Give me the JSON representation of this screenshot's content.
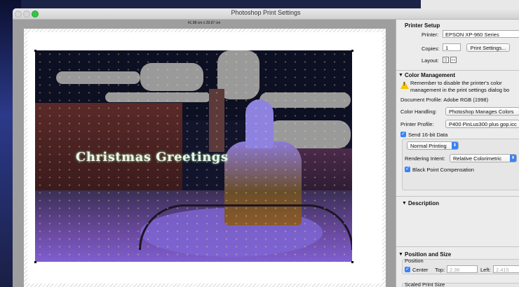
{
  "window": {
    "title": "Photoshop Print Settings"
  },
  "preview": {
    "paper_size": "41.98 cm x 29.67 cm",
    "overlay_text": "Christmas Greetings"
  },
  "printer_setup": {
    "header": "Printer Setup",
    "printer_label": "Printer:",
    "printer_value": "EPSON XP-960 Series",
    "copies_label": "Copies:",
    "copies_value": "1",
    "print_settings_button": "Print Settings...",
    "layout_label": "Layout:"
  },
  "color_management": {
    "header": "Color Management",
    "warning_line1": "Remember to disable the printer's color",
    "warning_line2": "management in the print settings dialog bo",
    "document_profile": "Document Profile: Adobe RGB (1998)",
    "color_handling_label": "Color Handling:",
    "color_handling_value": "Photoshop Manages Colors",
    "printer_profile_label": "Printer Profile:",
    "printer_profile_value": "P400 PinLus300 plus gop.icc",
    "send_16bit_label": "Send 16-bit Data",
    "send_16bit_checked": true,
    "normal_printing_value": "Normal Printing",
    "rendering_intent_label": "Rendering Intent:",
    "rendering_intent_value": "Relative Colorimetric",
    "black_point_label": "Black Point Compensation",
    "black_point_checked": true
  },
  "description": {
    "header": "Description"
  },
  "position_size": {
    "header": "Position and Size",
    "position_group": "Position",
    "center_label": "Center",
    "center_checked": true,
    "top_label": "Top:",
    "top_value": "2.36",
    "left_label": "Left:",
    "left_value": "2.415",
    "scaled_print_size": "Scaled Print Size"
  },
  "icons": {
    "disclosure": "triangle-down-icon",
    "warning": "warning-icon",
    "checkbox": "checkmark-icon",
    "popup": "popup-arrows-icon"
  },
  "colors": {
    "accent": "#3a82f7",
    "panel_bg": "#ececec",
    "preview_bg": "#9e9e9e",
    "warning": "#f5c400"
  }
}
